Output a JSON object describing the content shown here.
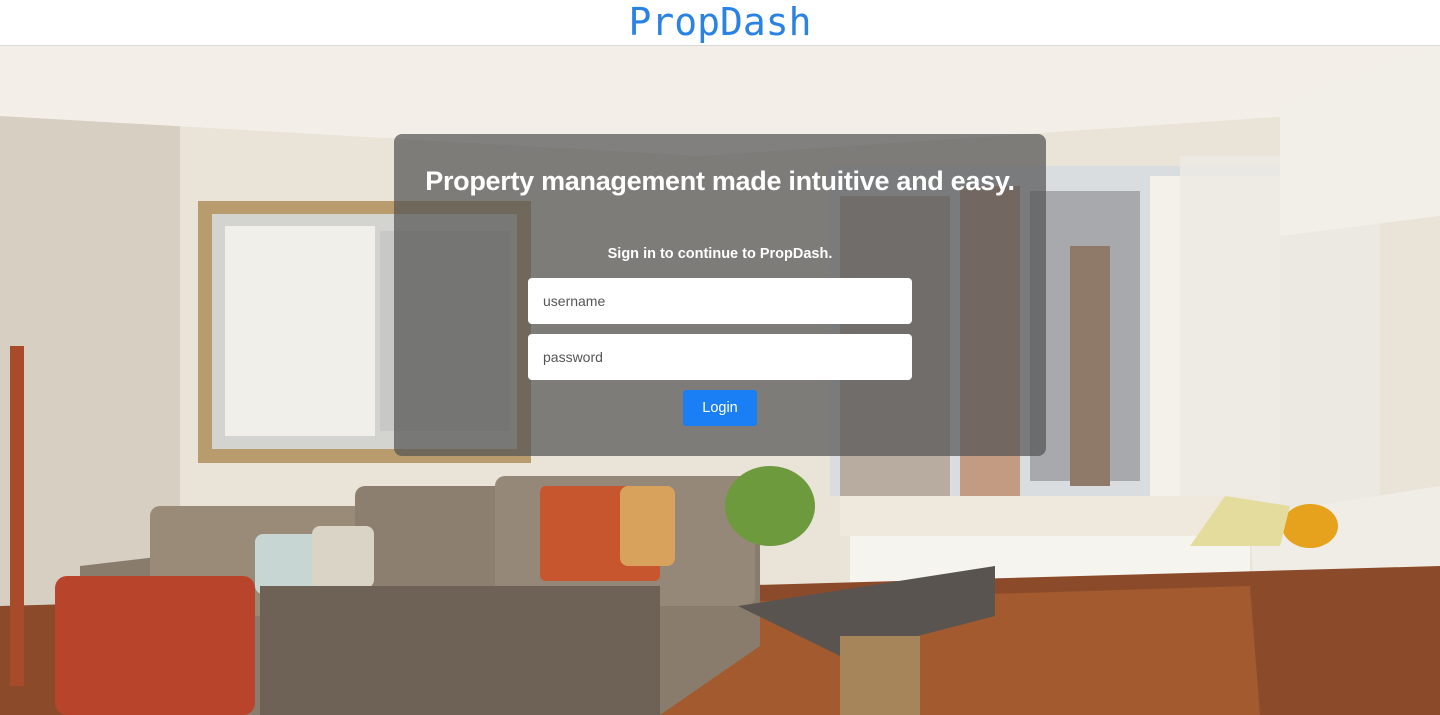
{
  "app": {
    "brand": "PropDash"
  },
  "login": {
    "headline": "Property management made intuitive and easy.",
    "subheading": "Sign in to continue to PropDash.",
    "username_placeholder": "username",
    "password_placeholder": "password",
    "login_label": "Login"
  },
  "colors": {
    "brand": "#2a82e4",
    "button": "#1a7ff5",
    "panel_overlay": "rgba(85,85,85,0.72)"
  },
  "background": {
    "image": "living-room-photo"
  }
}
